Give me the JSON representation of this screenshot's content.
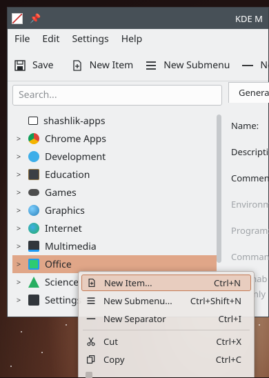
{
  "window": {
    "title": "KDE M"
  },
  "menubar": [
    "File",
    "Edit",
    "Settings",
    "Help"
  ],
  "toolbar": {
    "save": "Save",
    "new_item": "New Item",
    "new_submenu": "New Submenu",
    "new_separator": "New"
  },
  "search": {
    "placeholder": "Search..."
  },
  "tree": [
    {
      "label": "shashlik-apps",
      "icon": "folder-icon",
      "expandable": false,
      "color": "#ffffff"
    },
    {
      "label": "Chrome Apps",
      "icon": "chrome-icon",
      "expandable": true,
      "color": "#db4437"
    },
    {
      "label": "Development",
      "icon": "development-icon",
      "expandable": true,
      "color": "#3daee9"
    },
    {
      "label": "Education",
      "icon": "education-icon",
      "expandable": true,
      "color": "#3b3f44"
    },
    {
      "label": "Games",
      "icon": "games-icon",
      "expandable": true,
      "color": "#4d4d4d"
    },
    {
      "label": "Graphics",
      "icon": "graphics-icon",
      "expandable": true,
      "color": "#2980b9"
    },
    {
      "label": "Internet",
      "icon": "internet-icon",
      "expandable": true,
      "color": "#27ae60"
    },
    {
      "label": "Multimedia",
      "icon": "multimedia-icon",
      "expandable": true,
      "color": "#1d99f3"
    },
    {
      "label": "Office",
      "icon": "office-icon",
      "expandable": true,
      "color": "#2ecc71",
      "selected": true
    },
    {
      "label": "Science &",
      "icon": "science-icon",
      "expandable": true,
      "color": "#27ae60"
    },
    {
      "label": "Settings",
      "icon": "settings-icon",
      "expandable": true,
      "color": "#31363b"
    }
  ],
  "right_panel": {
    "tab": "Genera",
    "name_label": "Name:",
    "description_label": "Descriptio",
    "comment_label": "Commen",
    "environment_label": "Environm",
    "program_label": "Program:",
    "command_label": "Comman",
    "enable_label": "Enab",
    "only_label": "nly"
  },
  "context_menu": [
    {
      "label": "New Item...",
      "shortcut": "Ctrl+N",
      "icon": "new-item-icon",
      "highlighted": true
    },
    {
      "label": "New Submenu...",
      "shortcut": "Ctrl+Shift+N",
      "icon": "new-submenu-icon"
    },
    {
      "label": "New Separator",
      "shortcut": "Ctrl+I",
      "icon": "new-separator-icon"
    },
    {
      "label": "Cut",
      "shortcut": "Ctrl+X",
      "icon": "cut-icon"
    },
    {
      "label": "Copy",
      "shortcut": "Ctrl+C",
      "icon": "copy-icon"
    }
  ],
  "colors": {
    "selection": "#e0a688",
    "titlebar": "#475057",
    "accent": "#c47a55"
  }
}
